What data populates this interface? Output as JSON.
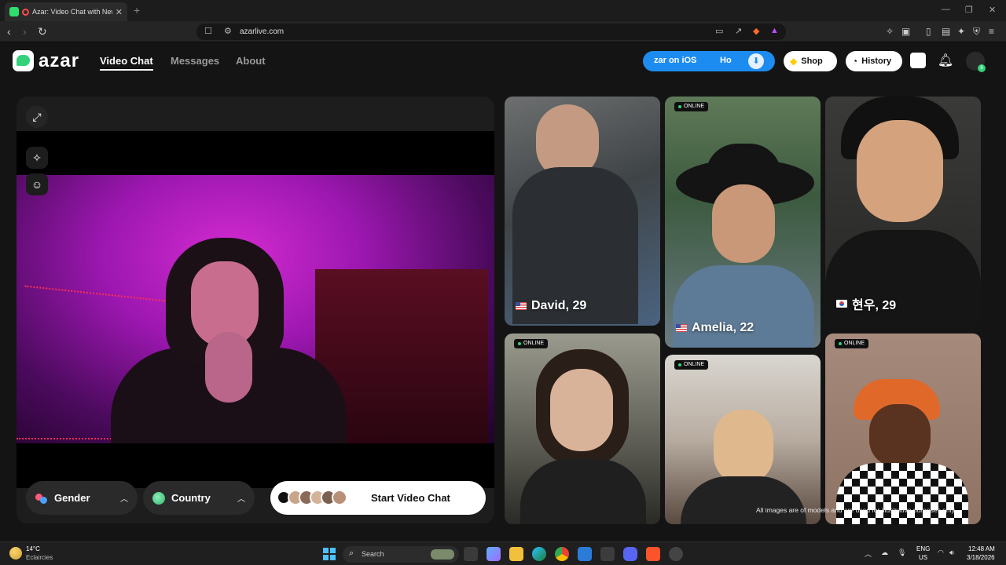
{
  "browser": {
    "tab_title": "Azar: Video Chat with New Pe",
    "tab_close": "✕",
    "new_tab": "+",
    "url": "azarlive.com",
    "window_controls": [
      "—",
      "❐",
      "✕"
    ]
  },
  "header": {
    "logo": "azar",
    "menu": [
      {
        "label": "Video Chat",
        "active": true
      },
      {
        "label": "Messages",
        "active": false
      },
      {
        "label": "About",
        "active": false
      }
    ],
    "ios_banner": {
      "text": "zar on iOS",
      "text2": "Ho"
    },
    "shop_label": "Shop",
    "history_label": "History",
    "notification_badge": "8"
  },
  "video": {
    "filters": [
      {
        "label": "Gender",
        "icon": "gender-icon"
      },
      {
        "label": "Country",
        "icon": "globe-icon"
      }
    ],
    "start_label": "Start Video Chat"
  },
  "gallery": {
    "online_label": "ONLINE",
    "cards": [
      {
        "name": "David, 29",
        "flag": "us",
        "online": false
      },
      {
        "name": "Amelia, 22",
        "flag": "us",
        "online": true
      },
      {
        "name": "현우, 29",
        "flag": "kr",
        "online": false
      },
      {
        "name": "",
        "flag": "",
        "online": true
      },
      {
        "name": "",
        "flag": "",
        "online": true
      },
      {
        "name": "",
        "flag": "",
        "online": true
      }
    ],
    "footnote": "All images are of models and are used for illustrative purposes only."
  },
  "taskbar": {
    "weather_temp": "14°C",
    "weather_desc": "Eclaircies",
    "search_placeholder": "Search",
    "lang": "ENG",
    "lang_region": "US",
    "time": "12:48 AM",
    "date": "3/18/2026"
  },
  "colors": {
    "accent_green": "#33d17a",
    "ios_blue": "#1d8cf0",
    "background": "#141414"
  }
}
